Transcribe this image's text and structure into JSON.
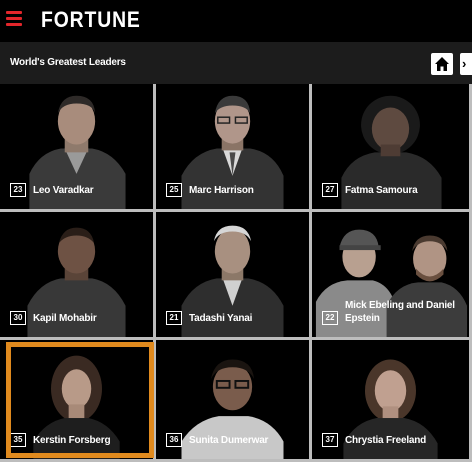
{
  "header": {
    "brand": "FORTUNE",
    "subtitle": "World's Greatest Leaders",
    "next_glyph": "›"
  },
  "colors": {
    "accent": "#e3262b",
    "highlight": "#e08a1e",
    "divider": "#bdbdbd",
    "subbar": "#1c1c1c"
  },
  "leaders": [
    {
      "rank": "23",
      "name": "Leo Varadkar"
    },
    {
      "rank": "25",
      "name": "Marc Harrison"
    },
    {
      "rank": "27",
      "name": "Fatma Samoura"
    },
    {
      "rank": "30",
      "name": "Kapil Mohabir"
    },
    {
      "rank": "21",
      "name": "Tadashi Yanai"
    },
    {
      "rank": "22",
      "name": "Mick Ebeling and Daniel Epstein"
    },
    {
      "rank": "35",
      "name": "Kerstin Forsberg"
    },
    {
      "rank": "36",
      "name": "Sunita Dumerwar"
    },
    {
      "rank": "37",
      "name": "Chrystia Freeland"
    }
  ]
}
